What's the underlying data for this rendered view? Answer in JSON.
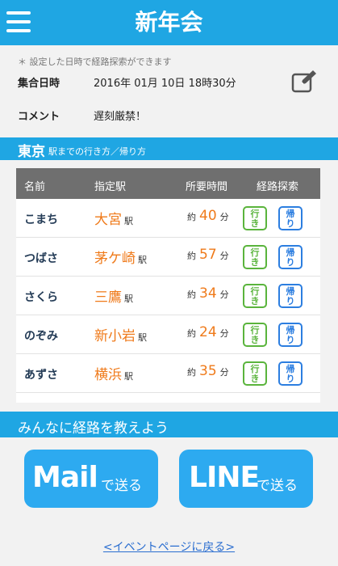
{
  "header": {
    "title": "新年会"
  },
  "event": {
    "note": "＊ 設定した日時で経路探索ができます",
    "datetime_label": "集合日時",
    "datetime_value": "2016年 01月 10日 18時30分",
    "comment_label": "コメント",
    "comment_value": "遅刻厳禁！"
  },
  "destination": {
    "name": "東京",
    "subtitle": "駅までの行き方／帰り方"
  },
  "table": {
    "headers": [
      "名前",
      "指定駅",
      "所要時間",
      "経路探索"
    ],
    "station_suffix": "駅",
    "time_prefix": "約",
    "time_unit": "分",
    "go_label": [
      "行",
      "き"
    ],
    "back_label": [
      "帰",
      "り"
    ],
    "rows": [
      {
        "name": "こまち",
        "station": "大宮",
        "minutes": "40"
      },
      {
        "name": "つばさ",
        "station": "茅ケ崎",
        "minutes": "57"
      },
      {
        "name": "さくら",
        "station": "三鷹",
        "minutes": "34"
      },
      {
        "name": "のぞみ",
        "station": "新小岩",
        "minutes": "24"
      },
      {
        "name": "あずさ",
        "station": "横浜",
        "minutes": "35"
      }
    ]
  },
  "share": {
    "title": "みんなに経路を教えよう",
    "mail_main": "Mail",
    "mail_sub": "で送る",
    "line_main": "LINE",
    "line_sub": "で送る"
  },
  "footer": {
    "back_link": "<イベントページに戻る>"
  },
  "colors": {
    "brand": "#1fa6e3",
    "accent": "#ef7a1a",
    "go": "#5ab43c",
    "back": "#2c7ee0"
  }
}
